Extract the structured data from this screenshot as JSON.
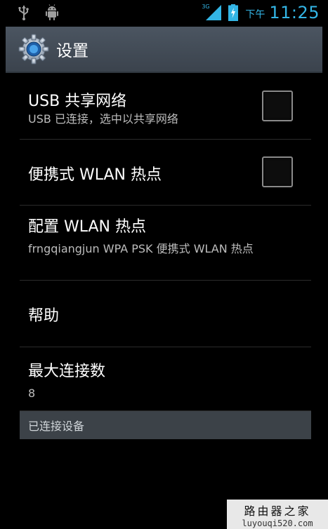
{
  "status_bar": {
    "network_type": "3G",
    "period": "下午",
    "time": "11:25",
    "icons": [
      "usb-icon",
      "android-debug-icon",
      "signal-icon",
      "battery-charging-icon"
    ],
    "accent_color": "#33b5e5"
  },
  "header": {
    "title": "设置",
    "icon": "settings-gear-icon"
  },
  "settings": {
    "usb_tethering": {
      "title": "USB 共享网络",
      "summary": "USB 已连接，选中以共享网络",
      "checked": false
    },
    "portable_hotspot": {
      "title": "便携式 WLAN 热点",
      "checked": false
    },
    "configure_hotspot": {
      "title": "配置 WLAN 热点",
      "summary": "frngqiangjun WPA PSK 便携式 WLAN 热点"
    },
    "help": {
      "title": "帮助"
    },
    "max_connections": {
      "title": "最大连接数",
      "value": "8"
    }
  },
  "section": {
    "connected_devices": "已连接设备"
  },
  "watermark": {
    "name": "路由器之家",
    "url": "luyouqi520.com"
  }
}
